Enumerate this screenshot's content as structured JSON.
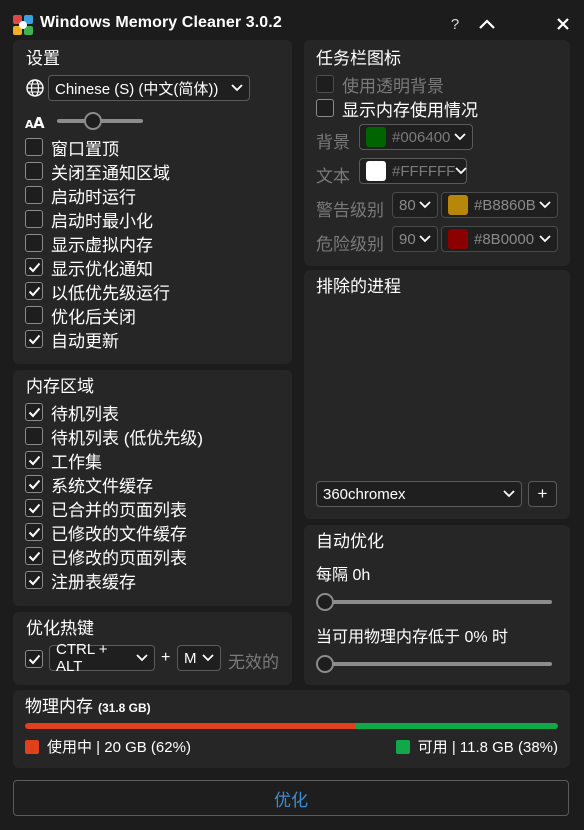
{
  "window": {
    "title": "Windows Memory Cleaner 3.0.2",
    "help_label": "?"
  },
  "settings": {
    "title": "设置",
    "language": "Chinese (S) (中文(简体))",
    "font_size_icon": "font-size-icon",
    "font_size_level": 0.4,
    "options": [
      {
        "label": "窗口置顶",
        "checked": false
      },
      {
        "label": "关闭至通知区域",
        "checked": false
      },
      {
        "label": "启动时运行",
        "checked": false
      },
      {
        "label": "启动时最小化",
        "checked": false
      },
      {
        "label": "显示虚拟内存",
        "checked": false
      },
      {
        "label": "显示优化通知",
        "checked": true
      },
      {
        "label": "以低优先级运行",
        "checked": true
      },
      {
        "label": "优化后关闭",
        "checked": false
      },
      {
        "label": "自动更新",
        "checked": true
      }
    ]
  },
  "memory_areas": {
    "title": "内存区域",
    "options": [
      {
        "label": "待机列表",
        "checked": true
      },
      {
        "label": "待机列表 (低优先级)",
        "checked": false
      },
      {
        "label": "工作集",
        "checked": true
      },
      {
        "label": "系统文件缓存",
        "checked": true
      },
      {
        "label": "已合并的页面列表",
        "checked": true
      },
      {
        "label": "已修改的文件缓存",
        "checked": true
      },
      {
        "label": "已修改的页面列表",
        "checked": true
      },
      {
        "label": "注册表缓存",
        "checked": true
      }
    ]
  },
  "hotkey": {
    "title": "优化热键",
    "enabled": true,
    "modifier": "CTRL + ALT",
    "plus": "+",
    "key": "M",
    "status": "无效的"
  },
  "tray_icon": {
    "title": "任务栏图标",
    "use_transparent_bg": "使用透明背景",
    "show_memory_usage": "显示内存使用情况",
    "background_label": "背景",
    "background_value": "#006400",
    "background_color": "#006400",
    "text_label": "文本",
    "text_value": "#FFFFFF",
    "text_color": "#FFFFFF",
    "warning_label": "警告级别",
    "warning_level": "80",
    "warning_value": "#B8860B",
    "warning_color": "#B8860B",
    "danger_label": "危险级别",
    "danger_level": "90",
    "danger_value": "#8B0000",
    "danger_color": "#8B0000"
  },
  "excluded": {
    "title": "排除的进程",
    "process": "360chromex",
    "add_label": "+"
  },
  "auto_optimize": {
    "title": "自动优化",
    "interval_label": "每隔 0h",
    "interval_value": 0,
    "threshold_label": "当可用物理内存低于 0% 时",
    "threshold_value": 0
  },
  "physical_memory": {
    "title": "物理内存",
    "total": "(31.8 GB)",
    "used_label": "使用中 | 20 GB (62%)",
    "used_percent": 62,
    "used_color": "#E0401A",
    "free_label": "可用 | 11.8 GB (38%)",
    "free_percent": 38,
    "free_color": "#11A84A"
  },
  "optimize_button": "优化",
  "colors": {
    "background": "#1C1C1C",
    "panel": "#262626",
    "accent": "#3B8FD6"
  }
}
